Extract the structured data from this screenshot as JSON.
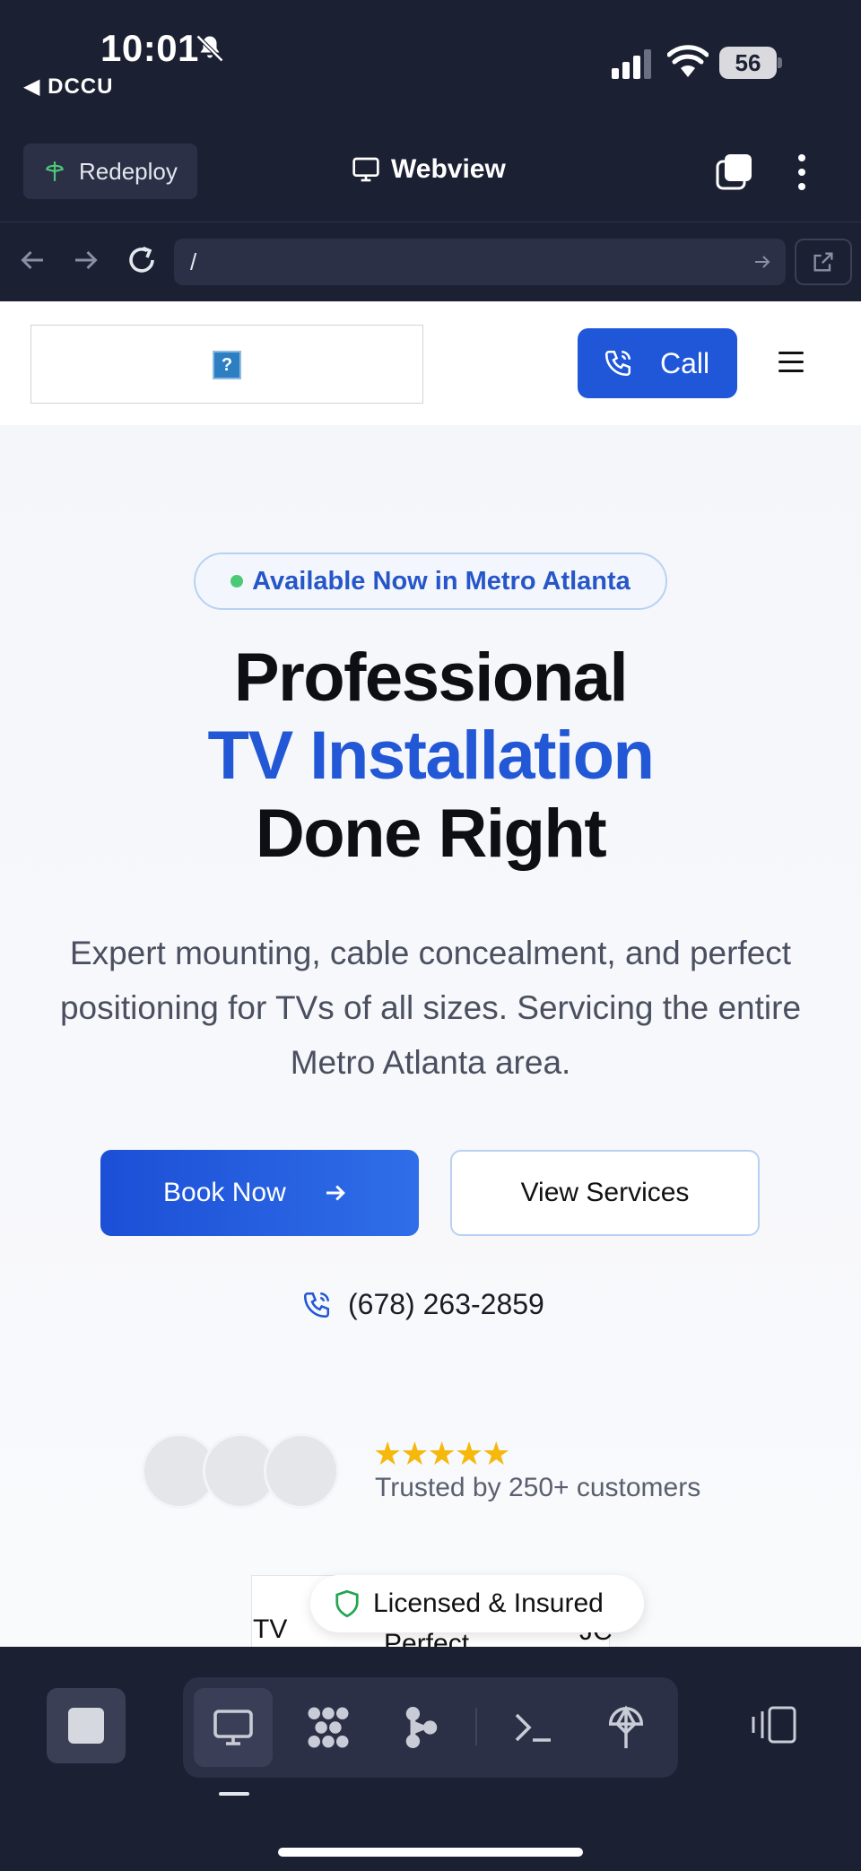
{
  "status_bar": {
    "time": "10:01",
    "back_app": "◀ DCCU",
    "battery": "56"
  },
  "toolbar": {
    "redeploy_label": "Redeploy",
    "webview_label": "Webview"
  },
  "url_bar": {
    "url": "/"
  },
  "site": {
    "call_label": "Call",
    "logo_placeholder": "?",
    "badge_text": "Available Now in Metro Atlanta",
    "headline_line1": "Professional",
    "headline_line2": "TV Installation",
    "headline_line3": "Done Right",
    "subtext": "Expert mounting, cable concealment, and perfect positioning for TVs of all sizes. Servicing the entire Metro Atlanta area.",
    "book_label": "Book Now",
    "services_label": "View Services",
    "phone": "(678) 263-2859",
    "stars": "★★★★★",
    "trusted_text": "Trusted by 250+ customers",
    "licensed_text": "Licensed & Insured",
    "peek_left": "TV",
    "peek_middle": "Perfect",
    "peek_right": "JC"
  },
  "colors": {
    "accent": "#2257d6",
    "dark_bg": "#1c2033",
    "star": "#f5b80b",
    "online_dot": "#4cc977",
    "shield": "#22a652"
  }
}
